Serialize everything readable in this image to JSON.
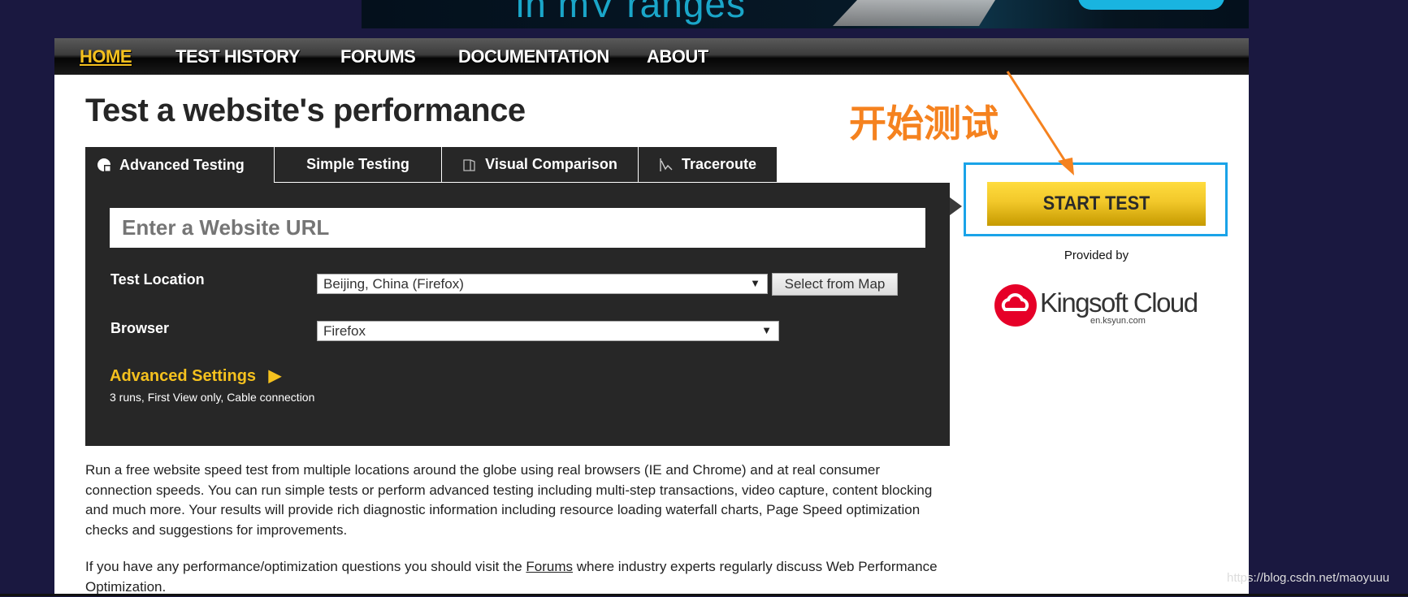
{
  "banner": {
    "text": "in mV ranges"
  },
  "nav": {
    "items": [
      {
        "label": "HOME",
        "active": true
      },
      {
        "label": "TEST HISTORY"
      },
      {
        "label": "FORUMS"
      },
      {
        "label": "DOCUMENTATION"
      },
      {
        "label": "ABOUT"
      }
    ]
  },
  "page_title": "Test a website's performance",
  "tabs": [
    {
      "label": "Advanced Testing",
      "icon": "pie-chart-icon",
      "active": true
    },
    {
      "label": "Simple Testing"
    },
    {
      "label": "Visual Comparison",
      "icon": "documents-icon"
    },
    {
      "label": "Traceroute",
      "icon": "traceroute-icon"
    }
  ],
  "form": {
    "url_placeholder": "Enter a Website URL",
    "test_location_label": "Test Location",
    "test_location_value": "Beijing, China (Firefox)",
    "select_from_map": "Select from Map",
    "browser_label": "Browser",
    "browser_value": "Firefox",
    "advanced_settings": "Advanced Settings",
    "advanced_summary": "3 runs, First View only, Cable connection"
  },
  "start_test": "START TEST",
  "provided_by": "Provided by",
  "sponsor": {
    "name": "Kingsoft Cloud",
    "url": "en.ksyun.com"
  },
  "annotation": {
    "text": "开始测试",
    "color": "#f5821f"
  },
  "intro": {
    "p1": "Run a free website speed test from multiple locations around the globe using real browsers (IE and Chrome) and at real consumer connection speeds. You can run simple tests or perform advanced testing including multi-step transactions, video capture, content blocking and much more. Your results will provide rich diagnostic information including resource loading waterfall charts, Page Speed optimization checks and suggestions for improvements.",
    "p2_before": "If you have any performance/optimization questions you should visit the ",
    "p2_link": "Forums",
    "p2_after": " where industry experts regularly discuss Web Performance Optimization."
  },
  "watermark": "https://blog.csdn.net/maoyuuu",
  "colors": {
    "accent": "#f5c11e",
    "highlight_box": "#1aa3e8",
    "panel": "#272727"
  }
}
